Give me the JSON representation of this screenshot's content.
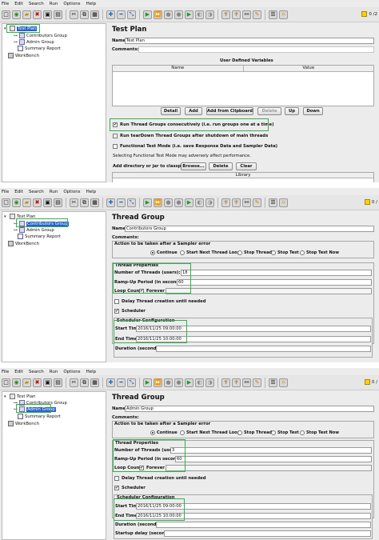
{
  "menu": [
    "File",
    "Edit",
    "Search",
    "Run",
    "Options",
    "Help"
  ],
  "toolbar": {
    "icons": [
      "new-icon",
      "templates-icon",
      "open-icon",
      "close-icon",
      "save-icon",
      "save-as-icon",
      "cut-icon",
      "copy-icon",
      "paste-icon",
      "expand-icon",
      "collapse-icon",
      "toggle-icon",
      "start-icon",
      "start-no-pauses-icon",
      "stop-icon",
      "shutdown-icon",
      "remote-start-icon",
      "remote-stop-icon",
      "remote-shutdown-icon",
      "clear-icon",
      "clear-all-icon",
      "search-icon",
      "reset-search-icon",
      "function-helper-icon",
      "help-icon"
    ],
    "counter_1": "0 /2",
    "counter_2": "0 /",
    "counter_3": "0 /"
  },
  "panel1": {
    "tree": {
      "test_plan": "Test Plan",
      "contributors": "Contributors Group",
      "admin": "Admin Group",
      "summary": "Summary Report",
      "workbench": "WorkBench"
    },
    "title": "Test Plan",
    "name_label": "Name:",
    "name_value": "Test Plan",
    "comments_label": "Comments:",
    "udv_title": "User Defined Variables",
    "col_name": "Name",
    "col_value": "Value",
    "buttons": {
      "detail": "Detail",
      "add": "Add",
      "add_clipboard": "Add from Clipboard",
      "delete": "Delete",
      "up": "Up",
      "down": "Down"
    },
    "chk_consecutive": "Run Thread Groups consecutively (i.e. run groups one at a time)",
    "chk_teardown": "Run tearDown Thread Groups after shutdown of main threads",
    "chk_functional": "Functional Test Mode (i.e. save Response Data and Sampler Data)",
    "functional_note": "Selecting Functional Test Mode may adversely affect performance.",
    "classpath_label": "Add directory or jar to classpath",
    "browse": "Browse...",
    "cp_delete": "Delete",
    "clear": "Clear",
    "library": "Library"
  },
  "panel2": {
    "tree": {
      "test_plan": "Test Plan",
      "contributors": "Contributors Group",
      "admin": "Admin Group",
      "summary": "Summary Report",
      "workbench": "WorkBench"
    },
    "title": "Thread Group",
    "name_label": "Name:",
    "name_value": "Contributors Group",
    "comments_label": "Comments:",
    "action_title": "Action to be taken after a Sampler error",
    "radios": [
      "Continue",
      "Start Next Thread Loop",
      "Stop Thread",
      "Stop Test",
      "Stop Test Now"
    ],
    "props_title": "Thread Properties",
    "threads_label": "Number of Threads (users):",
    "threads_value": "18",
    "ramp_label": "Ramp-Up Period (in seconds):",
    "ramp_value": "60",
    "loop_label": "Loop Count:",
    "forever": "Forever",
    "delay_label": "Delay Thread creation until needed",
    "scheduler_label": "Scheduler",
    "sched_title": "Scheduler Configuration",
    "start_label": "Start Time",
    "start_value": "2016/11/25 09:00:00",
    "end_label": "End Time",
    "end_value": "2016/11/25 10:00:00",
    "duration_label": "Duration (seconds)"
  },
  "panel3": {
    "tree": {
      "test_plan": "Test Plan",
      "contributors": "Contributors Group",
      "admin": "Admin Group",
      "summary": "Summary Report",
      "workbench": "WorkBench"
    },
    "title": "Thread Group",
    "name_label": "Name:",
    "name_value": "Admin Group",
    "comments_label": "Comments:",
    "action_title": "Action to be taken after a Sampler error",
    "radios": [
      "Continue",
      "Start Next Thread Loop",
      "Stop Thread",
      "Stop Test",
      "Stop Test Now"
    ],
    "props_title": "Thread Properties",
    "threads_label": "Number of Threads (users):",
    "threads_value": "3",
    "ramp_label": "Ramp-Up Period (in seconds):",
    "ramp_value": "60",
    "loop_label": "Loop Count:",
    "forever": "Forever",
    "delay_label": "Delay Thread creation until needed",
    "scheduler_label": "Scheduler",
    "sched_title": "Scheduler Configuration",
    "start_label": "Start Time",
    "start_value": "2016/11/25 09:00:00",
    "end_label": "End Time",
    "end_value": "2016/11/25 10:00:00",
    "duration_label": "Duration (seconds)",
    "startup_label": "Startup delay (seconds)"
  }
}
